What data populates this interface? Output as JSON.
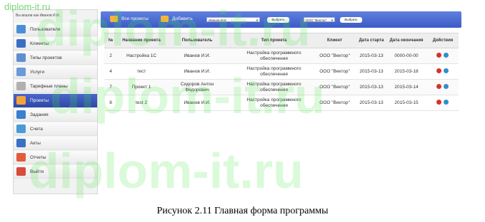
{
  "watermark": "diplom-it.ru",
  "sidebar": {
    "user_line": "Вы вошли как Иванов И.И.",
    "items": [
      {
        "label": "Пользователи",
        "icon": "users-icon",
        "color": "#4a8fd6"
      },
      {
        "label": "Клиенты",
        "icon": "clients-icon",
        "color": "#3a6fc4"
      },
      {
        "label": "Типы проектов",
        "icon": "project-types-icon",
        "color": "#5f8fd0"
      },
      {
        "label": "Услуги",
        "icon": "services-icon",
        "color": "#6a9ad8"
      },
      {
        "label": "Тарифные планы",
        "icon": "tariff-plans-icon",
        "color": "#b0b0b0"
      },
      {
        "label": "Проекты",
        "icon": "projects-icon",
        "color": "#f2a43a"
      },
      {
        "label": "Задания",
        "icon": "tasks-icon",
        "color": "#3b7fd0"
      },
      {
        "label": "Счета",
        "icon": "invoices-icon",
        "color": "#4a9ad8"
      },
      {
        "label": "Акты",
        "icon": "acts-icon",
        "color": "#3a6fc4"
      },
      {
        "label": "Отчеты",
        "icon": "reports-icon",
        "color": "#e25b3c"
      },
      {
        "label": "Выйти",
        "icon": "logout-icon",
        "color": "#d84a3a"
      }
    ]
  },
  "toolbar": {
    "all_projects_label": "Все проекты",
    "add_label": "Добавить",
    "user_select_value": "Иванов И.И.",
    "pick_label_1": "Выбрать",
    "client_select_value": "ООО \"Вектор\"",
    "pick_label_2": "Выбрать"
  },
  "table": {
    "headers": {
      "num": "№",
      "name": "Название проекта",
      "user": "Пользователь",
      "type": "Тип проекта",
      "client": "Клиент",
      "start": "Дата старта",
      "end": "Дата окончания",
      "actions": "Действия"
    },
    "rows": [
      {
        "num": "2",
        "name": "Настройка 1С",
        "user": "Иванов И.И.",
        "type": "Настройка программного обеспечения",
        "client": "ООО \"Вектор\"",
        "start": "2015-03-13",
        "end": "0000-00-00"
      },
      {
        "num": "4",
        "name": "тест",
        "user": "Иванов И.И.",
        "type": "Настройка программного обеспечения",
        "client": "ООО \"Вектор\"",
        "start": "2015-03-13",
        "end": "2015-03-18"
      },
      {
        "num": "7",
        "name": "Проект 1",
        "user": "Сидоров Антон Федорович",
        "type": "Настройка программного обеспечения",
        "client": "ООО \"Вектор\"",
        "start": "2015-03-13",
        "end": "2015-03-14"
      },
      {
        "num": "8",
        "name": "test 2",
        "user": "Иванов И.И.",
        "type": "Настройка программного обеспечения",
        "client": "ООО \"Вектор\"",
        "start": "2015-03-13",
        "end": "2015-03-15"
      }
    ]
  },
  "caption": "Рисунок 2.11 Главная форма программы",
  "colors": {
    "accent": "#3b5bc6",
    "active_item": "#2f4aa8",
    "delete": "#d8322b",
    "edit": "#2f8fc9"
  }
}
